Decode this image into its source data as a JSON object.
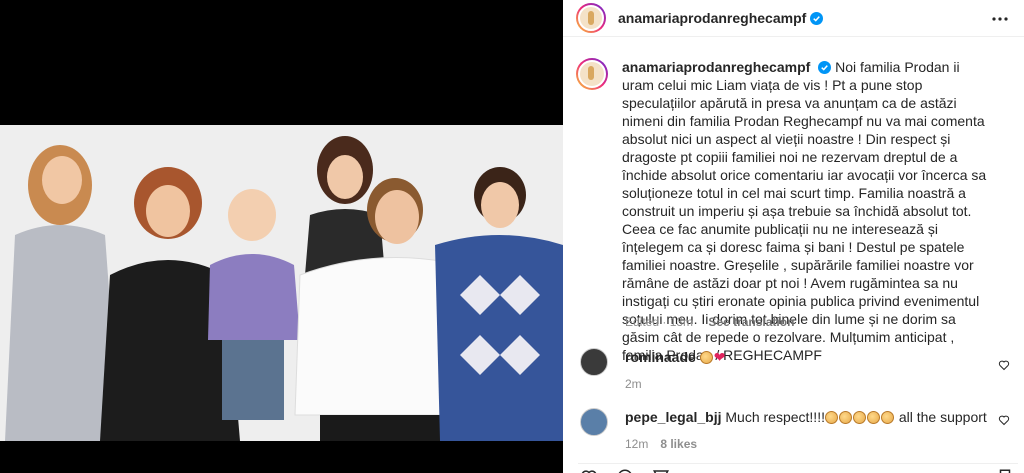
{
  "post": {
    "username": "anamariaprodanreghecampf",
    "caption": "Noi familia Prodan ii uram celui mic Liam viața de vis ! Pt a pune stop speculațiilor apărută in presa va anunțam ca de astăzi nimeni din familia Prodan Reghecampf nu va mai comenta absolut nici un aspect al vieții noastre ! Din respect și dragoste pt copiii familiei noi ne rezervam dreptul de a închide absolut orice comentariu iar avocații vor încerca sa soluționeze totul in cel mai scurt timp. Familia noastră a construit un imperiu și așa trebuie sa închidă absolut tot. Ceea ce fac anumite publicații nu ne interesează și înțelegem ca și doresc faima și bani ! Destul pe spatele familiei noastre. Greșelile , supărările familiei noastre vor rămâne de astăzi doar pt noi ! Avem rugămintea sa nu instigați cu știri eronate opinia publica privind evenimentul soțului meu. Ii dorim tot binele din lume și ne dorim sa găsim cât de repede o rezolvare. Mulțumim anticipat , familia Prodan / REGHECAMPF",
    "edited": "Edited",
    "time": "13m",
    "see_translation": "See translation"
  },
  "comments": [
    {
      "username": "rominaade",
      "text": "",
      "emojis": [
        "clap",
        "heart"
      ],
      "time": "2m",
      "likes": ""
    },
    {
      "username": "pepe_legal_bjj",
      "text": "Much respect!!!!",
      "emojis": [
        "clap",
        "clap",
        "clap",
        "clap",
        "clap"
      ],
      "text_after": " all the support",
      "time": "12m",
      "likes": "8 likes"
    }
  ],
  "colors": {
    "verified": "#0095f6",
    "muted": "#8e8e8e",
    "text": "#262626"
  },
  "icons": [
    "verified-badge-icon",
    "more-options-icon",
    "heart-icon",
    "comment-icon",
    "share-icon",
    "bookmark-icon"
  ]
}
